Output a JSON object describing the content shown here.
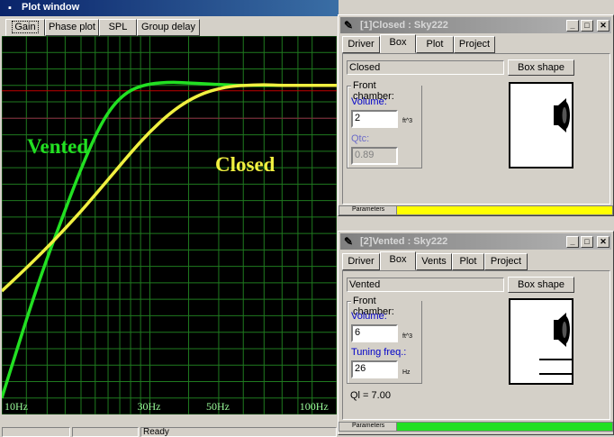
{
  "plot_window": {
    "title": "Plot window",
    "tabs": [
      {
        "label": "Gain",
        "active": true
      },
      {
        "label": "Phase plot",
        "active": false
      },
      {
        "label": "SPL",
        "active": false
      },
      {
        "label": "Group delay",
        "active": false
      }
    ],
    "status": [
      "",
      "",
      "Ready"
    ],
    "labels": {
      "vented": "Vented",
      "closed": "Closed"
    }
  },
  "colors": {
    "plot_bg": "#000000",
    "grid": "#1f7a1f",
    "reference_line": "#c00000",
    "reference_line2": "#8a2040",
    "vented_curve": "#22e022",
    "closed_curve": "#f0f040",
    "tick_text": "#9cff9c"
  },
  "chart_data": {
    "type": "line",
    "x_scale": "log",
    "xlim": [
      10,
      120
    ],
    "x_ticks": [
      {
        "value": 10,
        "label": "10Hz"
      },
      {
        "value": 30,
        "label": "30Hz"
      },
      {
        "value": 50,
        "label": "50Hz"
      },
      {
        "value": 100,
        "label": "100Hz"
      }
    ],
    "ylim": [
      -40,
      6
    ],
    "grid": true,
    "reference_levels": [
      0,
      -4
    ],
    "series": [
      {
        "name": "Vented",
        "color": "#22e022",
        "x": [
          10,
          11,
          12,
          13,
          14,
          15,
          17,
          19,
          21,
          23,
          25,
          27,
          30,
          35,
          40,
          45,
          50,
          60,
          70,
          85,
          100,
          120
        ],
        "y": [
          -38,
          -33,
          -28.5,
          -24.5,
          -21,
          -18,
          -12.5,
          -8,
          -4.5,
          -2.3,
          -1.0,
          -0.3,
          0.2,
          0.4,
          0.3,
          0.2,
          0.1,
          0.0,
          0.0,
          0.0,
          0.0,
          0.0
        ]
      },
      {
        "name": "Closed",
        "color": "#f0f040",
        "x": [
          10,
          12,
          14,
          16,
          18,
          20,
          23,
          26,
          30,
          35,
          40,
          45,
          50,
          55,
          60,
          70,
          80,
          100,
          120
        ],
        "y": [
          -25,
          -22.2,
          -19.7,
          -17.4,
          -15.3,
          -13.3,
          -10.6,
          -8.2,
          -5.6,
          -3.3,
          -1.8,
          -0.9,
          -0.4,
          -0.1,
          0.0,
          0.1,
          0.0,
          0.0,
          0.0
        ]
      }
    ]
  },
  "closed_window": {
    "title": "[1]Closed : Sky222",
    "tabs": [
      {
        "label": "Driver",
        "active": false
      },
      {
        "label": "Box",
        "active": true
      },
      {
        "label": "Plot",
        "active": false
      },
      {
        "label": "Project",
        "active": false
      }
    ],
    "type_value": "Closed",
    "box_shape_button": "Box shape",
    "group_label": "Front chamber:",
    "volume_label": "Volume:",
    "volume_value": "2",
    "volume_unit": "ft^3",
    "qtc_label": "Qtc:",
    "qtc_value": "0.89",
    "params_label": "Parameters",
    "strip_color": "#ffff00"
  },
  "vented_window": {
    "title": "[2]Vented : Sky222",
    "tabs": [
      {
        "label": "Driver",
        "active": false
      },
      {
        "label": "Box",
        "active": true
      },
      {
        "label": "Vents",
        "active": false
      },
      {
        "label": "Plot",
        "active": false
      },
      {
        "label": "Project",
        "active": false
      }
    ],
    "type_value": "Vented",
    "box_shape_button": "Box shape",
    "group_label": "Front chamber:",
    "volume_label": "Volume:",
    "volume_value": "6",
    "volume_unit": "ft^3",
    "tuning_label": "Tuning freq.:",
    "tuning_value": "26",
    "tuning_unit": "Hz",
    "ql_text": "Ql = 7.00",
    "params_label": "Parameters",
    "strip_color": "#22e022"
  }
}
